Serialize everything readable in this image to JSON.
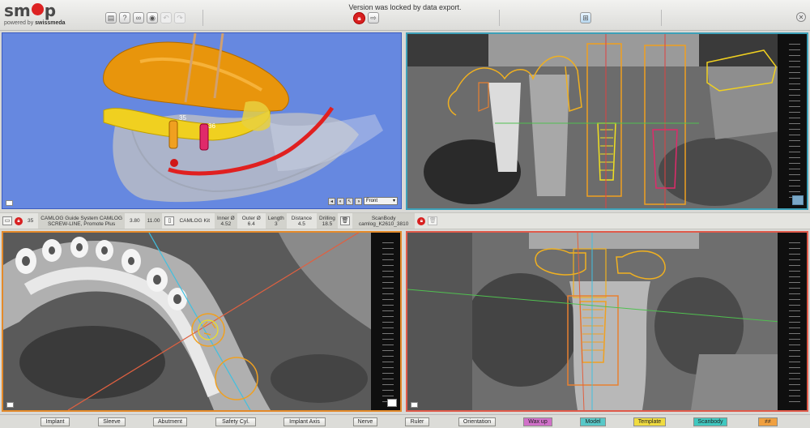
{
  "header": {
    "logo_pre": "sm",
    "logo_post": "p",
    "powered_prefix": "powered by",
    "powered_brand": "swissmeda",
    "lock_message": "Version was locked by data export.",
    "colors": {
      "lock_red": "#d82020",
      "close": "#888888"
    }
  },
  "toolbar_icons": [
    "save-icon",
    "help-icon",
    "binoculars-icon",
    "camera-icon",
    "undo-icon",
    "redo-icon",
    "lock-icon",
    "export-icon",
    "layout-icon",
    "close-icon"
  ],
  "view3d": {
    "tooth_labels": [
      "35",
      "36"
    ],
    "view_select": "Front",
    "background": "#6688e0"
  },
  "implant_bar": {
    "tooth": "35",
    "system_line1": "CAMLOG Guide System CAMLOG",
    "system_line2": "SCREW-LINE, Promote Plus",
    "diameter": "3.80",
    "length": "11.00",
    "kit": "CAMLOG Kit",
    "inner_label": "Inner Ø",
    "inner_value": "4.52",
    "outer_label": "Outer Ø",
    "outer_value": "6.4",
    "length_label": "Length",
    "length_value": "3",
    "distance_label": "Distance",
    "distance_value": "4.5",
    "drilling_label": "Drilling",
    "drilling_value": "18.5",
    "scanbody_label": "ScanBody",
    "scanbody_value": "camlog_K2610_3810"
  },
  "bottom_buttons": {
    "implant": "Implant",
    "sleeve": "Sleeve",
    "abutment": "Abutment",
    "safety_cyl": "Safety Cyl.",
    "implant_axis": "Implant Axis",
    "nerve": "Nerve",
    "ruler": "Ruler",
    "orientation": "Orientation",
    "wax_up": "Wax up",
    "model": "Model",
    "template": "Template",
    "scanbody": "Scanbody",
    "extra": "≠≠"
  },
  "button_colors": {
    "wax_up": "#d070c8",
    "model": "#58c8c8",
    "template": "#f0dc40",
    "scanbody": "#40c8c0",
    "extra": "#f0a040"
  },
  "viewport_borders": {
    "top_right": "#3da0b8",
    "bottom_left": "#e48a2a",
    "bottom_right": "#e05a4a"
  }
}
